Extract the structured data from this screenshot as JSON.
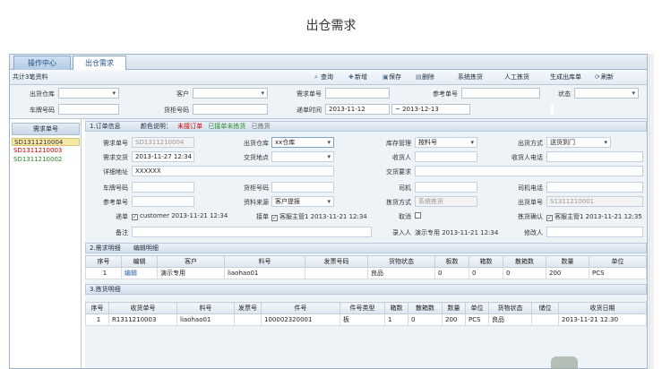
{
  "page_title": "出仓需求",
  "tabs": [
    {
      "label": "操作中心",
      "active": false
    },
    {
      "label": "出仓需求",
      "active": true
    }
  ],
  "toolbar": {
    "record_count": "共计3笔资料",
    "buttons": [
      {
        "label": "查询",
        "icon": "search-icon"
      },
      {
        "label": "新增",
        "icon": "add-icon"
      },
      {
        "label": "保存",
        "icon": "save-icon"
      },
      {
        "label": "删除",
        "icon": "delete-icon"
      },
      {
        "label": "系统拣货",
        "icon": ""
      },
      {
        "label": "人工拣货",
        "icon": ""
      },
      {
        "label": "生成出库单",
        "icon": ""
      },
      {
        "label": "刷新",
        "icon": "refresh-icon"
      }
    ]
  },
  "filter": {
    "warehouse_label": "出货仓库",
    "customer_label": "客户",
    "req_no_label": "需求单号",
    "ref_no_label": "参考单号",
    "status_label": "状态",
    "plate_label": "车牌号码",
    "cabinet_label": "货柜号码",
    "date_label": "递单时间",
    "date_from": "2013-11-12",
    "date_to": "~ 2013-12-13"
  },
  "left_list": {
    "header": "需求单号",
    "items": [
      {
        "label": "SD1311210004",
        "color": "#333333",
        "selected": true
      },
      {
        "label": "SD1311210003",
        "color": "#cc0000",
        "selected": false
      },
      {
        "label": "SD1311210002",
        "color": "#2a8a2a",
        "selected": false
      }
    ]
  },
  "order_info": {
    "section_title": "1.订单信息",
    "color_legend_label": "颜色说明：",
    "legend_unaccepted": "未接订单",
    "legend_unaccepted_color": "#cc0000",
    "legend_accepted": "已接单未拣货",
    "legend_accepted_color": "#2a8a2a",
    "legend_picked": "已拣货",
    "legend_picked_color": "#666666",
    "req_no_label": "需求单号",
    "req_no": "SD1311210004",
    "warehouse_label": "出货仓库",
    "warehouse": "xx仓库",
    "stock_mgmt_label": "库存管理",
    "stock_mgmt": "按料号",
    "ship_method_label": "出货方式",
    "ship_method": "送货到门",
    "req_date_label": "需求交货",
    "req_date": "2013-11-27 12:34",
    "delivery_place_label": "交货地点",
    "receiver_label": "收货人",
    "receiver_phone_label": "收货人电话",
    "address_label": "详细地址",
    "address": "XXXXXX",
    "delivery_req_label": "交货要求",
    "plate_label": "车牌号码",
    "cabinet_label": "货柜号码",
    "driver_label": "司机",
    "driver_phone_label": "司机电话",
    "ref_no_label": "参考单号",
    "source_label": "资料来源",
    "source": "客户提报",
    "pick_method_label": "拣货方式",
    "pick_method": "系统拣货",
    "out_no_label": "出货单号",
    "out_no": "S1311210001",
    "submit_label": "递单",
    "submit_value": "customer 2013-11-21 12:34",
    "accept_label": "接单",
    "accept_value": "客服主管1 2013-11-21 12:34",
    "cancel_label": "取消",
    "pick_confirm_label": "拣货确认",
    "pick_confirm_value": "客服主管1 2013-11-21 12:35",
    "remark_label": "备注",
    "entry_label": "录入人",
    "entry_value": "演示专用 2013-11-21 12:34",
    "modifier_label": "修改人"
  },
  "demand_detail": {
    "section_title": "2.需求明细",
    "edit_link": "编辑明细",
    "columns": [
      "序号",
      "编辑",
      "客户",
      "料号",
      "发票号码",
      "货物状态",
      "板数",
      "箱数",
      "散箱数",
      "数量",
      "单位"
    ],
    "rows": [
      [
        "1",
        "编辑",
        "演示专用",
        "liaohao01",
        "",
        "良品",
        "0",
        "0",
        "0",
        "200",
        "PCS"
      ]
    ]
  },
  "pick_detail": {
    "section_title": "3.拣货明细",
    "columns": [
      "序号",
      "收货单号",
      "料号",
      "发票号",
      "件号",
      "件号类型",
      "箱数",
      "散箱数",
      "数量",
      "单位",
      "货物状态",
      "储位",
      "收货日期"
    ],
    "rows": [
      [
        "1",
        "R1311210003",
        "liaohao01",
        "",
        "100002320001",
        "板",
        "1",
        "0",
        "200",
        "PCS",
        "良品",
        "",
        "2013-11-21 12:30"
      ]
    ]
  }
}
